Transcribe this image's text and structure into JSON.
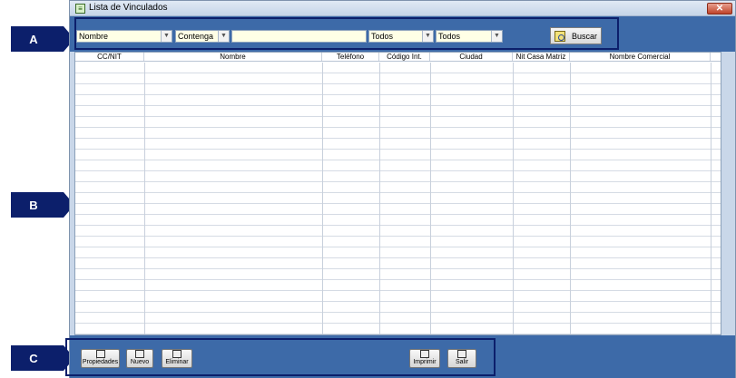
{
  "markers": {
    "a": "A",
    "b": "B",
    "c": "C"
  },
  "window": {
    "title": "Lista de Vinculados",
    "close_label": "✕"
  },
  "filters": {
    "field": "Nombre",
    "operator": "Contenga",
    "search_value": "",
    "filter1": "Todos",
    "filter2": "Todos",
    "search_button": "Buscar"
  },
  "grid": {
    "columns": [
      "CC/NIT",
      "Nombre",
      "Teléfono",
      "Código Int.",
      "Ciudad",
      "Nit Casa Matriz",
      "Nombre Comercial"
    ]
  },
  "toolbar": {
    "properties": "Propiedades",
    "new": "Nuevo",
    "delete": "Eliminar",
    "print": "Imprimir",
    "exit": "Salir"
  }
}
